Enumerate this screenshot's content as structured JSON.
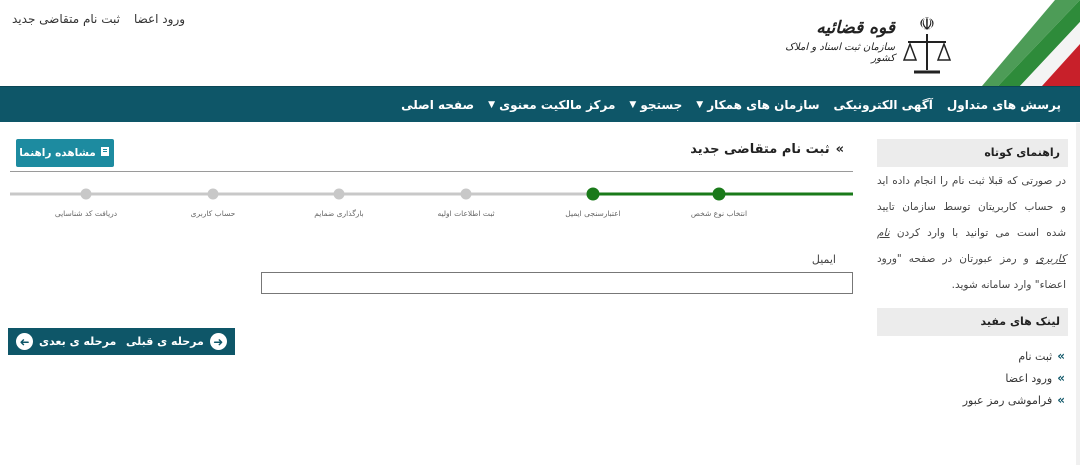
{
  "header": {
    "top_links": [
      "ثبت نام متقاضی جدید",
      "ورود اعضا"
    ],
    "logo_line1": "قوه قضائیه",
    "logo_line2": "سازمان ثبت اسناد و املاک کشور"
  },
  "nav": {
    "items": [
      {
        "label": "صفحه اصلی",
        "dropdown": false
      },
      {
        "label": "مرکز مالکیت معنوی",
        "dropdown": true
      },
      {
        "label": "جستجو",
        "dropdown": true
      },
      {
        "label": "سازمان های همکار",
        "dropdown": true
      },
      {
        "label": "آگهی الکترونیکی",
        "dropdown": false
      },
      {
        "label": "پرسش های متداول",
        "dropdown": false
      }
    ]
  },
  "sidebar": {
    "guide_title": "راهنمای کوتاه",
    "guide_text_1": "در صورتی که قبلا ثبت نام را انجام داده اید و حساب کاربریتان توسط سازمان تایید شده است می توانید با وارد کردن",
    "guide_text_u": "نام کاربری",
    "guide_text_2": "و رمز عبورتان در صفحه \"ورود اعضاء\" وارد سامانه شوید.",
    "links_title": "لینک های مفید",
    "links": [
      "ثبت نام",
      "ورود اعضا",
      "فراموشی رمز عبور"
    ]
  },
  "main": {
    "title": "ثبت نام متقاضی جدید",
    "guide_button": "مشاهده راهنما",
    "steps": [
      "انتخاب نوع شخص",
      "اعتبارسنجی ایمیل",
      "ثبت اطلاعات اولیه",
      "بارگذاری ضمایم",
      "حساب کاربری",
      "دریافت کد شناسایی"
    ],
    "completed_steps": 2,
    "email_label": "ایمیل",
    "email_value": "",
    "prev_button": "مرحله ی قبلی",
    "next_button": "مرحله ی بعدی"
  },
  "colors": {
    "nav_bg": "#0e5668",
    "accent_button": "#1d8ba0",
    "step_active": "#1a7a1a",
    "step_inactive": "#c8c8c8"
  }
}
